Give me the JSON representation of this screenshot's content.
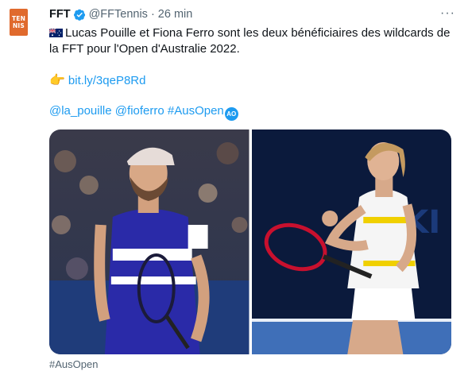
{
  "tweet": {
    "avatar": {
      "line1": "TEN",
      "line2": "NIS"
    },
    "author_name": "FFT",
    "author_handle": "@FFTennis",
    "separator": "·",
    "time": "26 min",
    "more": "···",
    "text": "Lucas Pouille et Fiona Ferro sont les deux bénéficiaires des wildcards de la FFT pour l'Open d'Australie 2022.",
    "point_emoji": "👉",
    "link": "bit.ly/3qeP8Rd",
    "mentions": [
      "@la_pouille",
      "@fioferro",
      "#AusOpen"
    ],
    "ao_badge": "AO",
    "footer_hashtag": "#AusOpen"
  },
  "colors": {
    "link": "#1d9bf0",
    "avatar": "#e06a2d",
    "secondary_text": "#536471"
  },
  "icons": [
    "verified-badge-icon",
    "australia-flag-icon",
    "pointing-hand-icon",
    "ao-logo-icon",
    "more-icon"
  ]
}
